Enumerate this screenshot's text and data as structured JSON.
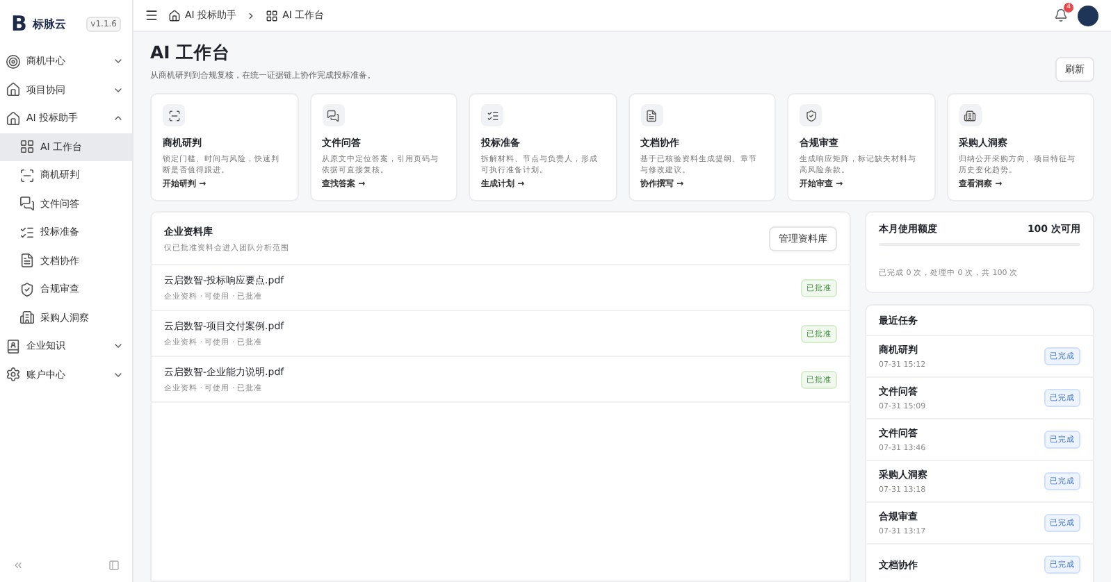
{
  "brand": {
    "mark": "B",
    "name": "标脉云",
    "version": "v1.1.6"
  },
  "sidebar": {
    "items": [
      {
        "label": "商机中心",
        "kind": "target",
        "expanded": false,
        "selected": false
      },
      {
        "label": "项目协同",
        "kind": "home",
        "expanded": false,
        "selected": false
      },
      {
        "label": "AI 投标助手",
        "kind": "home",
        "expanded": true,
        "selected": false,
        "children": [
          {
            "label": "AI 工作台",
            "kind": "grid",
            "selected": true
          },
          {
            "label": "商机研判",
            "kind": "scan",
            "selected": false
          },
          {
            "label": "文件问答",
            "kind": "chat",
            "selected": false
          },
          {
            "label": "投标准备",
            "kind": "list",
            "selected": false
          },
          {
            "label": "文档协作",
            "kind": "doc",
            "selected": false
          },
          {
            "label": "合规审查",
            "kind": "shield",
            "selected": false
          },
          {
            "label": "采购人洞察",
            "kind": "building",
            "selected": false
          }
        ]
      },
      {
        "label": "企业知识",
        "kind": "book",
        "expanded": false,
        "selected": false
      },
      {
        "label": "账户中心",
        "kind": "gear",
        "expanded": false,
        "selected": false
      }
    ]
  },
  "breadcrumb": [
    {
      "label": "AI 投标助手",
      "kind": "home"
    },
    {
      "label": "AI 工作台",
      "kind": "grid"
    }
  ],
  "notifications": {
    "count": "4"
  },
  "page": {
    "title": "AI 工作台",
    "subtitle": "从商机研判到合规复核，在统一证据链上协作完成投标准备。",
    "refresh": "刷新"
  },
  "cards": [
    {
      "kind": "scan",
      "title": "商机研判",
      "desc": "锁定门槛、时间与风险，快速判断是否值得跟进。",
      "link": "开始研判 →"
    },
    {
      "kind": "chat",
      "title": "文件问答",
      "desc": "从原文中定位答案，引用页码与依据可直接复核。",
      "link": "查找答案 →"
    },
    {
      "kind": "list",
      "title": "投标准备",
      "desc": "拆解材料、节点与负责人，形成可执行准备计划。",
      "link": "生成计划 →"
    },
    {
      "kind": "doc",
      "title": "文档协作",
      "desc": "基于已核验资料生成提纲、章节与修改建议。",
      "link": "协作撰写 →"
    },
    {
      "kind": "shield",
      "title": "合规审查",
      "desc": "生成响应矩阵，标记缺失材料与高风险条款。",
      "link": "开始审查 →"
    },
    {
      "kind": "building",
      "title": "采购人洞察",
      "desc": "归纳公开采购方向、项目特征与历史变化趋势。",
      "link": "查看洞察 →"
    }
  ],
  "library": {
    "title": "企业资料库",
    "subtitle": "仅已批准资料会进入团队分析范围",
    "button": "管理资料库",
    "files": [
      {
        "name": "云启数智-投标响应要点.pdf",
        "meta": "企业资料 · 可使用 · 已批准",
        "status": "已批准"
      },
      {
        "name": "云启数智-项目交付案例.pdf",
        "meta": "企业资料 · 可使用 · 已批准",
        "status": "已批准"
      },
      {
        "name": "云启数智-企业能力说明.pdf",
        "meta": "企业资料 · 可使用 · 已批准",
        "status": "已批准"
      }
    ]
  },
  "quota": {
    "title": "本月使用额度",
    "available": "100 次可用",
    "level": 0,
    "summary": "已完成 0 次，处理中 0 次，共 100 次"
  },
  "tasks": {
    "title": "最近任务",
    "items": [
      {
        "name": "商机研判",
        "time": "07-31 15:12",
        "status": "已完成"
      },
      {
        "name": "文件问答",
        "time": "07-31 15:09",
        "status": "已完成"
      },
      {
        "name": "文件问答",
        "time": "07-31 13:46",
        "status": "已完成"
      },
      {
        "name": "采购人洞察",
        "time": "07-31 13:18",
        "status": "已完成"
      },
      {
        "name": "合规审查",
        "time": "07-31 13:17",
        "status": "已完成"
      },
      {
        "name": "文档协作",
        "status": "已完成"
      }
    ]
  }
}
